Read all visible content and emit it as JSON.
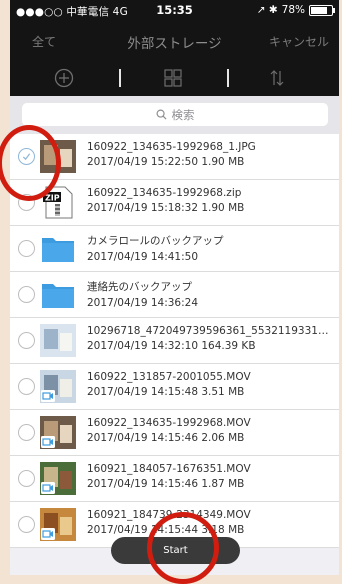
{
  "status_bar": {
    "carrier": "●●●○○ 中華電信 4G",
    "time": "15:35",
    "icons": "↗ ✱",
    "battery": "78%",
    "battery_level": 0.78
  },
  "nav": {
    "left_label": "全て",
    "title": "外部ストレージ",
    "right_label": "キャンセル"
  },
  "toolbar": {
    "icons": [
      "plus-circle-icon",
      "grid-icon",
      "sort-icon"
    ]
  },
  "search": {
    "placeholder": "検索",
    "icon": "search-icon"
  },
  "files": [
    {
      "name": "160922_134635-1992968_1.JPG",
      "meta": "2017/04/19 15:22:50  1.90 MB",
      "kind": "photo",
      "checked": true
    },
    {
      "name": "160922_134635-1992968.zip",
      "meta": "2017/04/19 15:18:32  1.90 MB",
      "kind": "zip",
      "checked": false
    },
    {
      "name": "カメラロールのバックアップ",
      "meta": "2017/04/19 14:41:50",
      "kind": "folder",
      "checked": false
    },
    {
      "name": "連絡先のバックアップ",
      "meta": "2017/04/19 14:36:24",
      "kind": "folder",
      "checked": false
    },
    {
      "name": "10296718_472049739596361_5532119331…",
      "meta": "2017/04/19 14:32:10  164.39 KB",
      "kind": "photo",
      "checked": false
    },
    {
      "name": "160922_131857-2001055.MOV",
      "meta": "2017/04/19 14:15:48  3.51 MB",
      "kind": "video",
      "checked": false
    },
    {
      "name": "160922_134635-1992968.MOV",
      "meta": "2017/04/19 14:15:46  2.06 MB",
      "kind": "video",
      "checked": false
    },
    {
      "name": "160921_184057-1676351.MOV",
      "meta": "2017/04/19 14:15:46  1.87 MB",
      "kind": "video",
      "checked": false
    },
    {
      "name": "160921_184739-2314349.MOV",
      "meta": "2017/04/19 14:15:44  3.18 MB",
      "kind": "video",
      "checked": false
    }
  ],
  "start_button": {
    "label": "Start"
  },
  "colors": {
    "background": "#f2e3d2",
    "bar": "#141414",
    "folder": "#3d9be0",
    "annotation": "#d11d10",
    "checkmark": "#8fb7d9"
  }
}
